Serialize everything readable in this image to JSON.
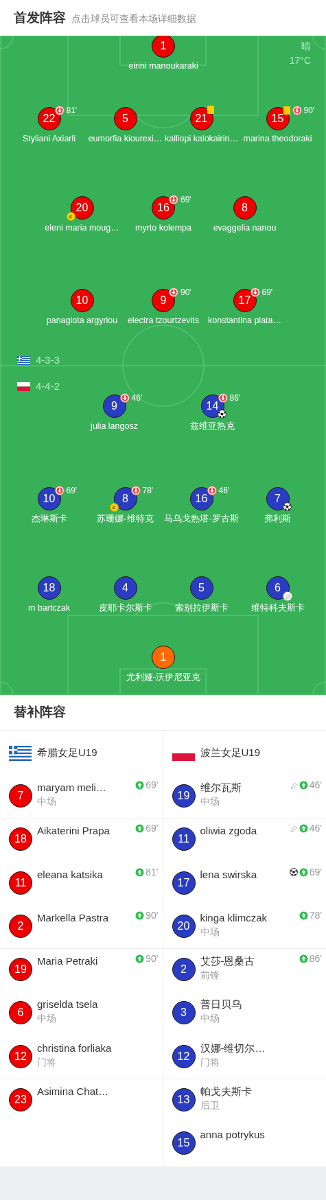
{
  "header": {
    "title": "首发阵容",
    "subtitle": "点击球员可查看本场详细数据"
  },
  "weather": {
    "condition": "晴",
    "temperature": "17°C"
  },
  "subs_title": "替补阵容",
  "teams": [
    {
      "name": "希腊女足U19",
      "flag": {
        "kind": "greece"
      },
      "formation": "4-3-3",
      "color": "#ee0000",
      "lines": [
        [
          {
            "number": "1",
            "name": "eirini manoukaraki"
          }
        ],
        [
          {
            "number": "22",
            "name": "Styliani Axiarli",
            "badges": [
              {
                "kind": "sub_off",
                "text": "81'"
              }
            ]
          },
          {
            "number": "5",
            "name": "eumorfia kiourexi…"
          },
          {
            "number": "21",
            "name": "kalliopi kalokairin…",
            "badges": [
              {
                "kind": "yellow_card"
              }
            ]
          },
          {
            "number": "15",
            "name": "marina theodoraki",
            "badges": [
              {
                "kind": "yellow_card"
              },
              {
                "kind": "sub_off",
                "text": "90'"
              }
            ]
          }
        ],
        [
          {
            "number": "20",
            "name": "eleni maria moug…",
            "badges": [
              {
                "kind": "captain",
                "text": "c"
              }
            ]
          },
          {
            "number": "16",
            "name": "myrto kolempa",
            "badges": [
              {
                "kind": "sub_off",
                "text": "69'"
              }
            ]
          },
          {
            "number": "8",
            "name": "evaggelia nanou"
          }
        ],
        [
          {
            "number": "10",
            "name": "panagiota argyriou"
          },
          {
            "number": "9",
            "name": "electra tzourtzevits",
            "badges": [
              {
                "kind": "sub_off",
                "text": "90'"
              }
            ]
          },
          {
            "number": "17",
            "name": "konstantina plata…",
            "badges": [
              {
                "kind": "sub_off",
                "text": "69'"
              }
            ]
          }
        ]
      ],
      "substitutes": [
        {
          "number": "7",
          "name": "maryam meli…",
          "position": "中场",
          "events": [
            {
              "kind": "sub_on",
              "text": "69'"
            }
          ]
        },
        {
          "number": "18",
          "name": "Aikaterini Prapa",
          "events": [
            {
              "kind": "sub_on",
              "text": "69'"
            }
          ]
        },
        {
          "number": "11",
          "name": "eleana katsika",
          "events": [
            {
              "kind": "sub_on",
              "text": "81'"
            }
          ]
        },
        {
          "number": "2",
          "name": "Markella Pastra",
          "events": [
            {
              "kind": "sub_on",
              "text": "90'"
            }
          ]
        },
        {
          "number": "19",
          "name": "Maria Petraki",
          "events": [
            {
              "kind": "sub_on",
              "text": "90'"
            }
          ]
        },
        {
          "number": "6",
          "name": "griselda tsela",
          "position": "中场"
        },
        {
          "number": "12",
          "name": "christina forliaka",
          "position": "门将"
        },
        {
          "number": "23",
          "name": "Asimina Chat…"
        }
      ]
    },
    {
      "name": "波兰女足U19",
      "flag": {
        "kind": "poland"
      },
      "formation": "4-4-2",
      "color": "#2a3dc2",
      "lines": [
        [
          {
            "number": "9",
            "name": "julia langosz",
            "badges": [
              {
                "kind": "sub_off",
                "text": "46'"
              }
            ]
          },
          {
            "number": "14",
            "name": "兹维亚热克",
            "badges": [
              {
                "kind": "sub_off",
                "text": "86'"
              },
              {
                "kind": "goal"
              }
            ]
          }
        ],
        [
          {
            "number": "10",
            "name": "杰琳斯卡",
            "badges": [
              {
                "kind": "sub_off",
                "text": "69'"
              }
            ]
          },
          {
            "number": "8",
            "name": "苏珊娜-维特克",
            "badges": [
              {
                "kind": "sub_off",
                "text": "78'"
              },
              {
                "kind": "captain",
                "text": "c"
              }
            ]
          },
          {
            "number": "16",
            "name": "马乌戈热塔-罗古斯",
            "badges": [
              {
                "kind": "sub_off",
                "text": "46'"
              }
            ]
          },
          {
            "number": "7",
            "name": "弗利斯",
            "badges": [
              {
                "kind": "goal"
              }
            ]
          }
        ],
        [
          {
            "number": "18",
            "name": "m bartczak"
          },
          {
            "number": "4",
            "name": "皮耶卡尔斯卡"
          },
          {
            "number": "5",
            "name": "索别拉伊斯卡"
          },
          {
            "number": "6",
            "name": "维特科夫斯卡",
            "badges": [
              {
                "kind": "assist"
              }
            ]
          }
        ],
        [
          {
            "number": "1",
            "name": "尤利娅-沃伊尼亚克",
            "color": "#ff6a00"
          }
        ]
      ],
      "substitutes": [
        {
          "number": "19",
          "name": "维尔瓦斯",
          "position": "中场",
          "events": [
            {
              "kind": "assist"
            },
            {
              "kind": "sub_on",
              "text": "46'"
            }
          ]
        },
        {
          "number": "11",
          "name": "oliwia zgoda",
          "events": [
            {
              "kind": "assist"
            },
            {
              "kind": "sub_on",
              "text": "46'"
            }
          ]
        },
        {
          "number": "17",
          "name": "lena swirska",
          "events": [
            {
              "kind": "goal"
            },
            {
              "kind": "sub_on",
              "text": "69'"
            }
          ]
        },
        {
          "number": "20",
          "name": "kinga klimczak",
          "position": "中场",
          "events": [
            {
              "kind": "sub_on",
              "text": "78'"
            }
          ]
        },
        {
          "number": "2",
          "name": "艾莎-恩桑古",
          "position": "前锋",
          "events": [
            {
              "kind": "sub_on",
              "text": "86'"
            }
          ]
        },
        {
          "number": "3",
          "name": "普日贝乌",
          "position": "中场"
        },
        {
          "number": "12",
          "name": "汉娜-维切尔…",
          "position": "门将"
        },
        {
          "number": "13",
          "name": "帕戈夫斯卡",
          "position": "后卫"
        },
        {
          "number": "15",
          "name": "anna potrykus"
        }
      ]
    }
  ]
}
